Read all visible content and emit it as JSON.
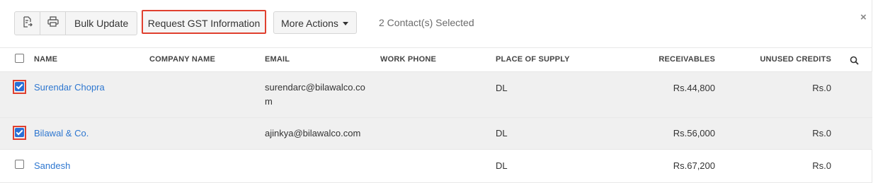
{
  "toolbar": {
    "icons": [
      "export-icon",
      "print-icon"
    ],
    "bulk_update_label": "Bulk Update",
    "request_gst_label": "Request GST Information",
    "more_actions_label": "More Actions",
    "selection_status": "2 Contact(s) Selected",
    "close_glyph": "×"
  },
  "table": {
    "columns": [
      "NAME",
      "COMPANY NAME",
      "EMAIL",
      "WORK PHONE",
      "PLACE OF SUPPLY",
      "RECEIVABLES",
      "UNUSED CREDITS"
    ],
    "search_icon": "search-icon",
    "rows": [
      {
        "checked": true,
        "name": "Surendar Chopra",
        "company": "",
        "email": "surendarc@bilawalco.com",
        "work_phone": "",
        "place_of_supply": "DL",
        "receivables": "Rs.44,800",
        "unused_credits": "Rs.0"
      },
      {
        "checked": true,
        "name": "Bilawal & Co.",
        "company": "",
        "email": "ajinkya@bilawalco.com",
        "work_phone": "",
        "place_of_supply": "DL",
        "receivables": "Rs.56,000",
        "unused_credits": "Rs.0"
      },
      {
        "checked": false,
        "name": "Sandesh",
        "company": "",
        "email": "",
        "work_phone": "",
        "place_of_supply": "DL",
        "receivables": "Rs.67,200",
        "unused_credits": "Rs.0"
      }
    ]
  },
  "colors": {
    "accent_link": "#2e77d0",
    "highlight_border": "#e0402f",
    "checkbox_checked": "#2a6fd6",
    "selected_row_bg": "#f0f0f0"
  }
}
